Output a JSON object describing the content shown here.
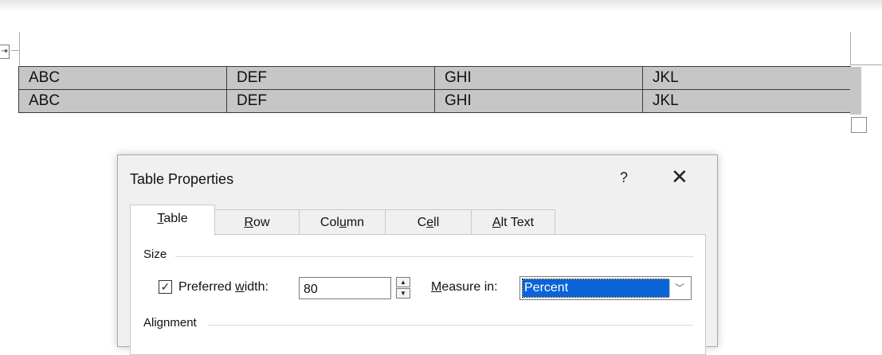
{
  "document": {
    "move_handle_glyph": "⇥",
    "table_rows": [
      [
        "ABC",
        "DEF",
        "GHI",
        "JKL"
      ],
      [
        "ABC",
        "DEF",
        "GHI",
        "JKL"
      ]
    ]
  },
  "dialog": {
    "title": "Table Properties",
    "help_label": "?",
    "close_label": "✕",
    "tabs": [
      {
        "pre": "",
        "key": "T",
        "post": "able"
      },
      {
        "pre": "",
        "key": "R",
        "post": "ow"
      },
      {
        "pre": "Col",
        "key": "u",
        "post": "mn"
      },
      {
        "pre": "C",
        "key": "e",
        "post": "ll"
      },
      {
        "pre": "",
        "key": "A",
        "post": "lt Text"
      }
    ],
    "active_tab_index": 0,
    "size_section": "Size",
    "preferred_width": {
      "checked": true,
      "check_glyph": "✓",
      "label_pre": "Preferred ",
      "label_key": "w",
      "label_post": "idth:",
      "value": "80"
    },
    "spinner": {
      "up": "▲",
      "down": "▼"
    },
    "measure_in": {
      "label_key": "M",
      "label_post": "easure in:",
      "value": "Percent",
      "arrow": "﹀"
    },
    "alignment_section": "Alignment"
  }
}
